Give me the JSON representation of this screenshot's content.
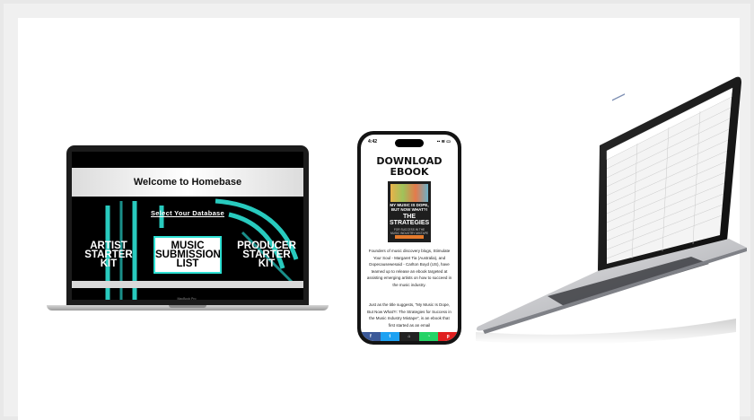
{
  "laptop_mbp": {
    "header_title": "Welcome to Homebase",
    "select_label": "Select Your Database",
    "tiles": [
      {
        "label": "ARTIST STARTER KIT"
      },
      {
        "label": "MUSIC SUBMISSION LIST"
      },
      {
        "label": "PRODUCER STARTER KIT"
      }
    ],
    "brand": "MacBook Pro"
  },
  "phone": {
    "time": "4:42",
    "status_icons": "▪▪ ≋ ▭",
    "title": "DOWNLOAD EBOOK",
    "book_cover": {
      "line1": "MY MUSIC IS DOPE, BUT NOW WHAT?!",
      "line2": "THE STRATEGIES",
      "line3": "FOR SUCCESS IN THE MUSIC INDUSTRY MIXTAPE"
    },
    "paragraph1": "Founders of music discovery blogs, Stimulate Your Soul - Margaret Tia (Australia), and Dopecausewesaid - Carlton Boyd (US), have teamed up to release an ebook targeted at assisting emerging artists on how to succeed in the music industry.",
    "paragraph2": "Just as the title suggests, \"My Music Is Dope, But Now What?!: The Strategies for Success in the Music Industry Mixtape\", is an ebook that first started as an email",
    "share_buttons": [
      {
        "icon": "facebook-icon",
        "glyph": "f",
        "color": "#3b5998"
      },
      {
        "icon": "twitter-icon",
        "glyph": "t",
        "color": "#1da1f2"
      },
      {
        "icon": "home-icon",
        "glyph": "⌂",
        "color": "#222222"
      },
      {
        "icon": "whatsapp-icon",
        "glyph": "◔",
        "color": "#25d366"
      },
      {
        "icon": "pinterest-icon",
        "glyph": "p",
        "color": "#e02020"
      }
    ]
  },
  "colors": {
    "accent_teal": "#2de0d3",
    "frame_bg": "#f0f0f0"
  }
}
